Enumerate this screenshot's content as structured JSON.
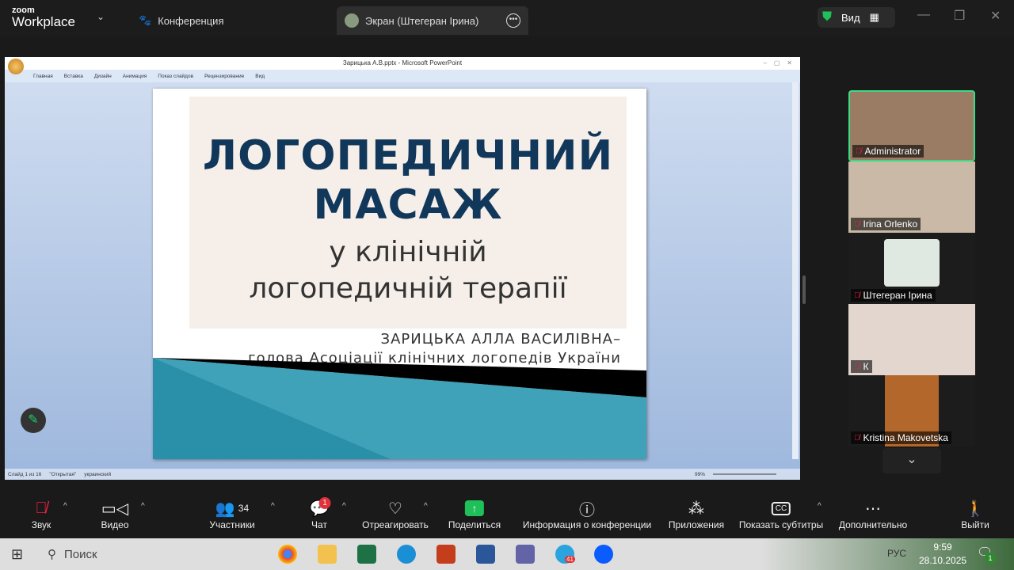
{
  "app": {
    "logo_top": "zoom",
    "logo_bottom": "Workplace",
    "meeting_tab": "Конференция",
    "screen_tab": "Экран (Штегеран Ірина)",
    "view_label": "Вид"
  },
  "ppt": {
    "title": "Зарицька А.В.pptx - Microsoft PowerPoint",
    "menu": [
      "Главная",
      "Вставка",
      "Дизайн",
      "Анимация",
      "Показ слайдов",
      "Рецензирование",
      "Вид"
    ],
    "status": {
      "slide": "Слайд 1 из 16",
      "theme": "\"Открытая\"",
      "language": "украинский",
      "zoom": "99%"
    }
  },
  "slide": {
    "title_line1": "ЛОГОПЕДИЧНИЙ",
    "title_line2": "МАСАЖ",
    "subtitle_line1": "у клінічній",
    "subtitle_line2": "логопедичній терапії",
    "author_line1": "ЗАРИЦЬКА АЛЛА ВАСИЛІВНА–",
    "author_line2": "голова Асоціації клінічних логопедів України"
  },
  "participants": [
    {
      "name": "Administrator",
      "active": true,
      "muted": true
    },
    {
      "name": "Irina Orlenko",
      "muted": true
    },
    {
      "name": "Штегеран Ірина",
      "muted": true
    },
    {
      "name": "К",
      "muted": true
    },
    {
      "name": "Kristina Makovetska",
      "muted": true
    }
  ],
  "toolbar": {
    "audio": "Звук",
    "video": "Видео",
    "participants": "Участники",
    "participants_count": "34",
    "chat": "Чат",
    "chat_badge": "1",
    "react": "Отреагировать",
    "share": "Поделиться",
    "info": "Информация о конференции",
    "apps": "Приложения",
    "captions": "Показать субтитры",
    "more": "Дополнительно",
    "leave": "Выйти"
  },
  "taskbar": {
    "search": "Поиск",
    "telegram_badge": "41",
    "lang": "РУС",
    "time": "9:59",
    "date": "28.10.2025",
    "notif_count": "1"
  },
  "colors": {
    "share": "#1fbf5a",
    "leave": "#e0323c",
    "active_border": "#3ddc84",
    "slide_title": "#11375a"
  }
}
